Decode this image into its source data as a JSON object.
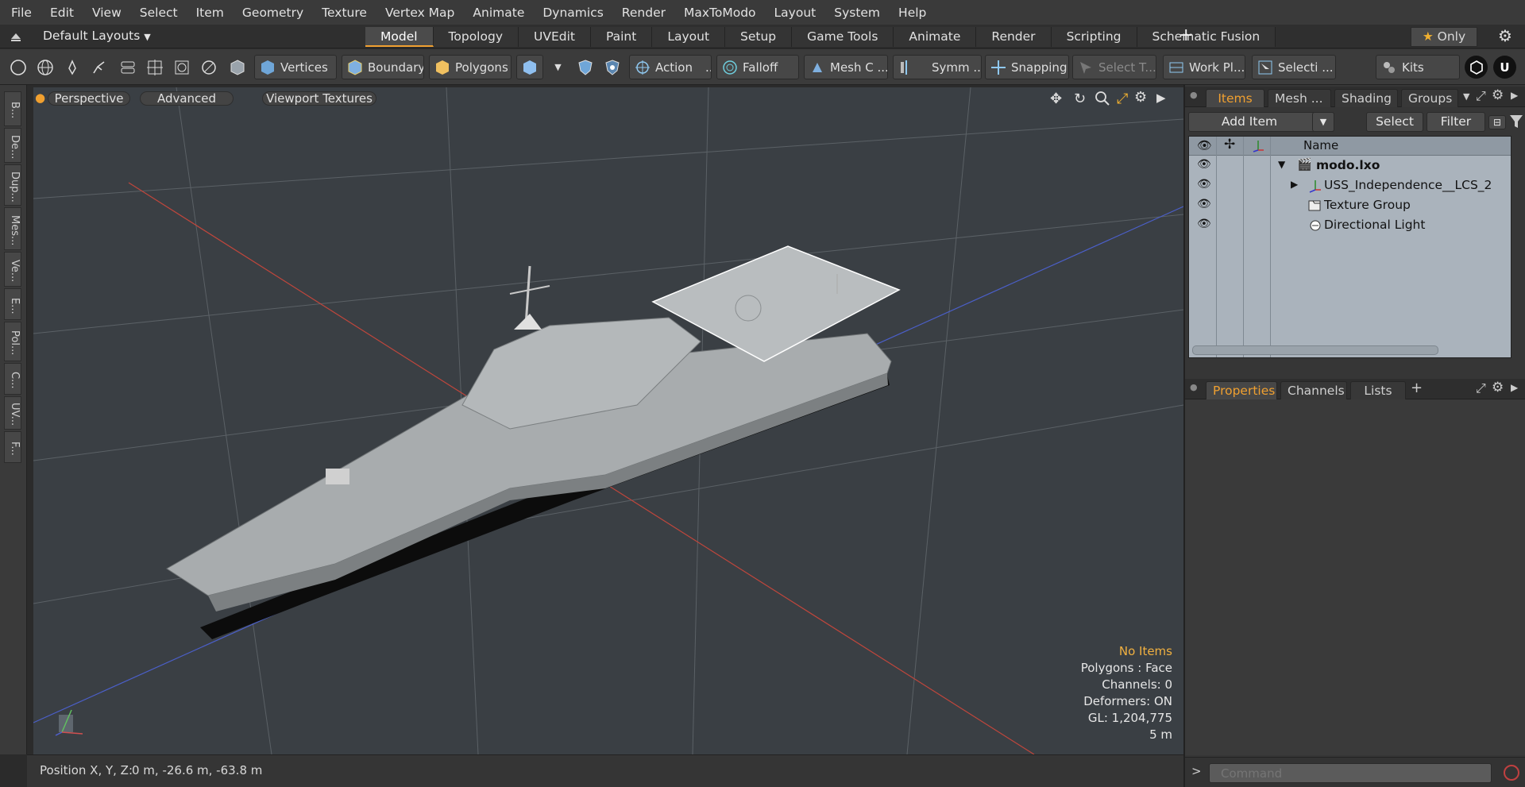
{
  "menubar": {
    "items": [
      "File",
      "Edit",
      "View",
      "Select",
      "Item",
      "Geometry",
      "Texture",
      "Vertex Map",
      "Animate",
      "Dynamics",
      "Render",
      "MaxToModo",
      "Layout",
      "System",
      "Help"
    ]
  },
  "layoutbar": {
    "layout_menu": "Default Layouts",
    "tabs": [
      "Model",
      "Topology",
      "UVEdit",
      "Paint",
      "Layout",
      "Setup",
      "Game Tools",
      "Animate",
      "Render",
      "Scripting",
      "Schematic Fusion"
    ],
    "active_tab": "Model",
    "add_tab_icon": "plus-icon",
    "only_label": "Only"
  },
  "toolbar": {
    "vertices": "Vertices",
    "boundary": "Boundary",
    "polygons": "Polygons",
    "action": "Action",
    "action_more": "...",
    "falloff": "Falloff",
    "mesh_c": "Mesh C ...",
    "symm": "Symm ...",
    "snapping": "Snapping",
    "select_t": "Select T...",
    "work_pl": "Work Pl...",
    "selecti": "Selecti ...",
    "kits": "Kits"
  },
  "leftstrip": {
    "tabs": [
      "B...",
      "De...",
      "Dup...",
      "Mes...",
      "Ve...",
      "E...",
      "Pol...",
      "C...",
      "UV...",
      "F..."
    ]
  },
  "viewport": {
    "perspective": "Perspective",
    "advanced": "Advanced",
    "viewport_textures": "Viewport Textures",
    "info": {
      "selection": "No Items",
      "polygons": "Polygons : Face",
      "channels": "Channels: 0",
      "deformers": "Deformers: ON",
      "gl": "GL: 1,204,775",
      "scale": "5 m"
    },
    "colors": {
      "background": "#3a3f44",
      "x_axis": "#c0463c",
      "z_axis": "#4b5fc8",
      "grid": "#5b6166"
    }
  },
  "statusbar": {
    "position_label": "Position X, Y, Z:",
    "position_value": "0 m, -26.6 m, -63.8 m"
  },
  "items_panel": {
    "tabs": [
      "Items",
      "Mesh ...",
      "Shading",
      "Groups"
    ],
    "active_tab": "Items",
    "add_item": "Add Item",
    "select": "Select",
    "filter": "Filter",
    "column_name": "Name",
    "tree": [
      {
        "label": "modo.lxo",
        "icon": "scene-icon"
      },
      {
        "label": "USS_Independence__LCS_2",
        "icon": "locator-icon"
      },
      {
        "label": "Texture Group",
        "icon": "texture-group-icon"
      },
      {
        "label": "Directional Light",
        "icon": "light-icon"
      }
    ]
  },
  "properties_panel": {
    "tabs": [
      "Properties",
      "Channels",
      "Lists"
    ],
    "active_tab": "Properties",
    "add_icon": "plus-icon"
  },
  "command": {
    "placeholder": "Command"
  }
}
